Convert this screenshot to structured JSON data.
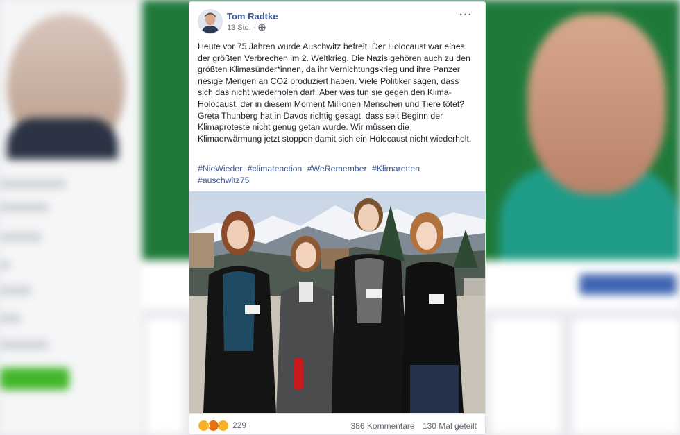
{
  "post": {
    "author": "Tom Radtke",
    "time": "13 Std.",
    "separator": "·",
    "privacy_icon": "globe-icon",
    "more_label": "···",
    "text": "Heute vor 75 Jahren wurde Auschwitz befreit. Der Holocaust war eines der größten Verbrechen im 2. Weltkrieg. Die Nazis gehören auch zu den größten Klimasünder*innen, da ihr Vernichtungskrieg und ihre Panzer riesige Mengen an CO2 produziert haben. Viele Politiker sagen, dass sich das nicht wiederholen darf. Aber was tun sie gegen den Klima-Holocaust, der in diesem Moment Millionen Menschen und Tiere tötet? Greta Thunberg hat in Davos richtig gesagt, dass seit Beginn der Klimaproteste nicht genug getan wurde. Wir müssen die Klimaerwärmung jetzt stoppen damit sich ein Holocaust nicht wiederholt.",
    "hashtags": [
      "#NieWieder",
      "#climateaction",
      "#WeRemember",
      "#Klimaretten",
      "#auschwitz75"
    ],
    "reactions": {
      "icons": [
        "haha-icon",
        "angry-icon",
        "wow-icon"
      ],
      "count": "229"
    },
    "comments": "386 Kommentare",
    "shares": "130 Mal geteilt"
  },
  "colors": {
    "link": "#385898",
    "text": "#1d2129",
    "meta": "#606770"
  }
}
